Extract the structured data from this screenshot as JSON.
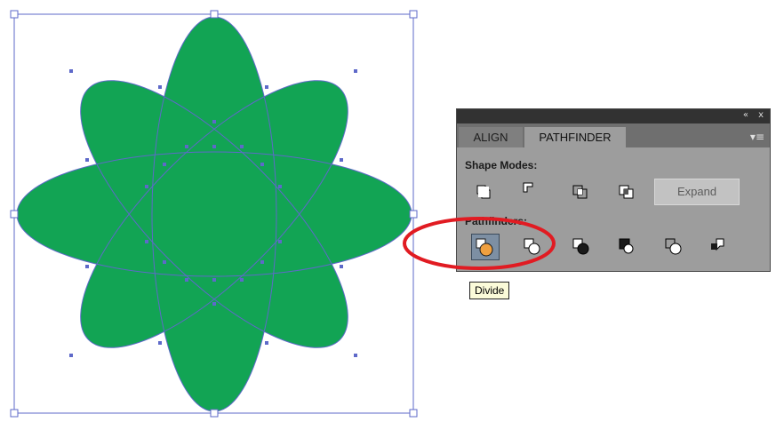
{
  "panel": {
    "tabs": [
      {
        "label": "ALIGN"
      },
      {
        "label": "PATHFINDER"
      }
    ],
    "titlebar": {
      "collapse_icon": "«",
      "close_icon": "x"
    },
    "menu_icon": "▾≡",
    "shape_modes_label": "Shape Modes:",
    "pathfinders_label": "Pathfinders:",
    "expand_label": "Expand"
  },
  "tooltip": {
    "text": "Divide"
  },
  "colors": {
    "flower_fill": "#12a454",
    "selection_stroke": "#5e69c9",
    "highlight_ring": "#e11b22"
  }
}
